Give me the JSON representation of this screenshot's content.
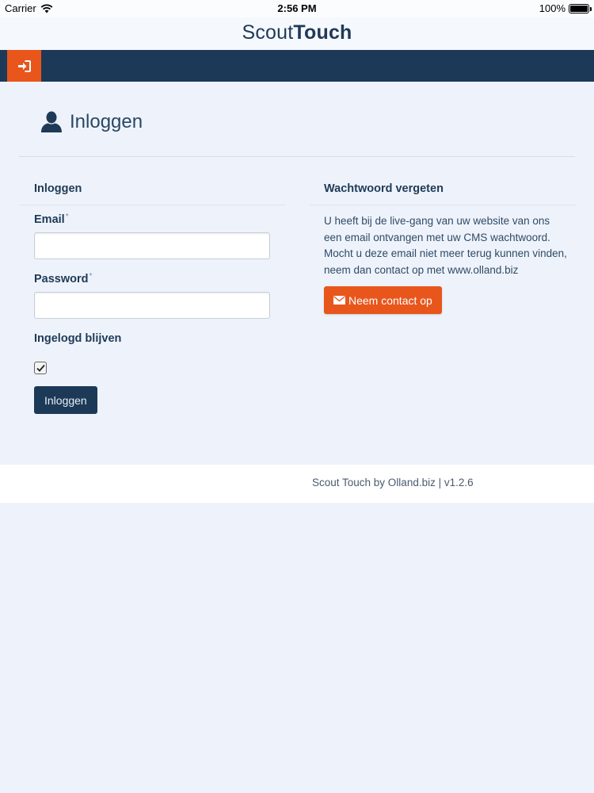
{
  "status_bar": {
    "carrier": "Carrier",
    "time": "2:56 PM",
    "battery": "100%",
    "battery_level": 1.0
  },
  "brand": {
    "light": "Scout",
    "bold": "Touch"
  },
  "navbar": {
    "logout_icon": "sign-in-icon",
    "accent_color": "#e8561c",
    "background_color": "#1c3a57"
  },
  "page": {
    "title": "Inloggen",
    "title_icon": "user-icon"
  },
  "login_form": {
    "section_title": "Inloggen",
    "email_label": "Email",
    "email_required": "*",
    "email_value": "",
    "password_label": "Password",
    "password_required": "*",
    "password_value": "",
    "remember_label": "Ingelogd blijven",
    "remember_checked": true,
    "submit_label": "Inloggen"
  },
  "forgot_password": {
    "section_title": "Wachtwoord vergeten",
    "text": "U heeft bij de live-gang van uw website van ons een email ontvangen met uw CMS wachtwoord. Mocht u deze email niet meer terug kunnen vinden, neem dan contact op met www.olland.biz",
    "button_icon": "envelope-icon",
    "button_label": "Neem contact op"
  },
  "footer": {
    "text": "Scout Touch by Olland.biz | v1.2.6"
  }
}
